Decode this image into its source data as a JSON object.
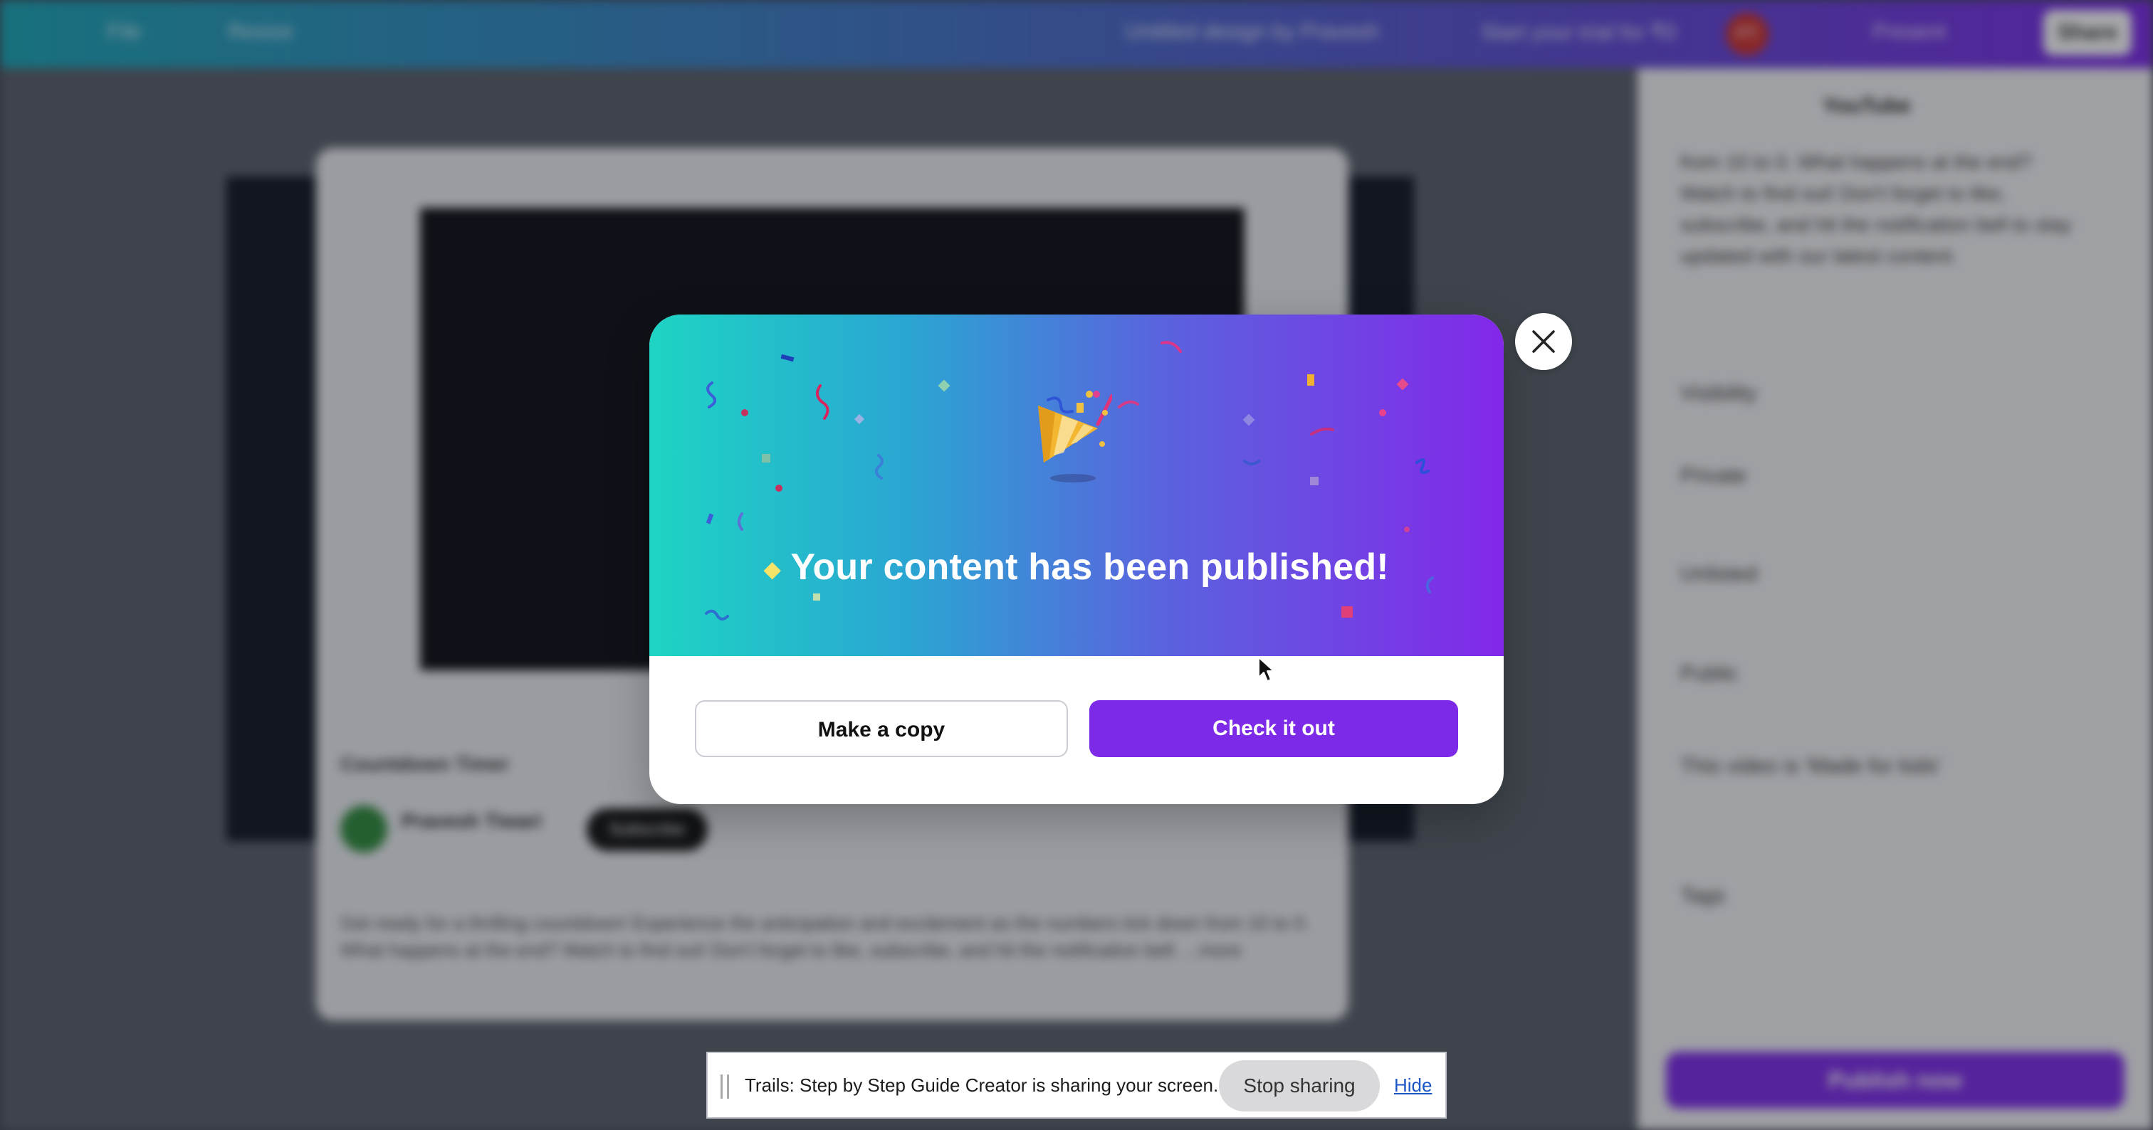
{
  "background_app": {
    "topbar": {
      "file_label": "File",
      "resize_label": "Resize",
      "design_title": "Untitled design by Pravesh",
      "trial_label": "Start your trial for ₹0",
      "avatar_initials": "PT",
      "present_label": "Present",
      "share_label": "Share"
    },
    "preview_card": {
      "video_title": "Countdown Timer",
      "channel_name": "Pravesh Tiwari",
      "subscribe_label": "Subscribe",
      "description": "Get ready for a thrilling countdown! Experience the anticipation and excitement as the numbers tick down from 10 to 0. What happens at the end? Watch to find out! Don't forget to like, subscribe, and hit the notification bell. ...more"
    },
    "side_panel": {
      "title": "YouTube",
      "description_snippet": "from 10 to 0. What happens at the end? Watch to find out! Don't forget to like, subscribe, and hit the notification bell to stay updated with our latest content.",
      "visibility_label": "Visibility",
      "private_label": "Private",
      "unlisted_label": "Unlisted",
      "public_label": "Public",
      "kids_label": "This video is 'Made for kids'",
      "tags_label": "Tags",
      "publish_label": "Publish now"
    }
  },
  "modal": {
    "headline": "Your content has been published!",
    "copy_button": "Make a copy",
    "check_button": "Check it out",
    "close_icon": "close-icon",
    "illustration": "party-popper-icon"
  },
  "share_bar": {
    "message": "Trails: Step by Step Guide Creator is sharing your screen.",
    "stop_label": "Stop sharing",
    "hide_label": "Hide"
  },
  "colors": {
    "brand_purple": "#7d2ae8",
    "hero_start": "#1ed4c4",
    "hero_end": "#8328e9"
  }
}
